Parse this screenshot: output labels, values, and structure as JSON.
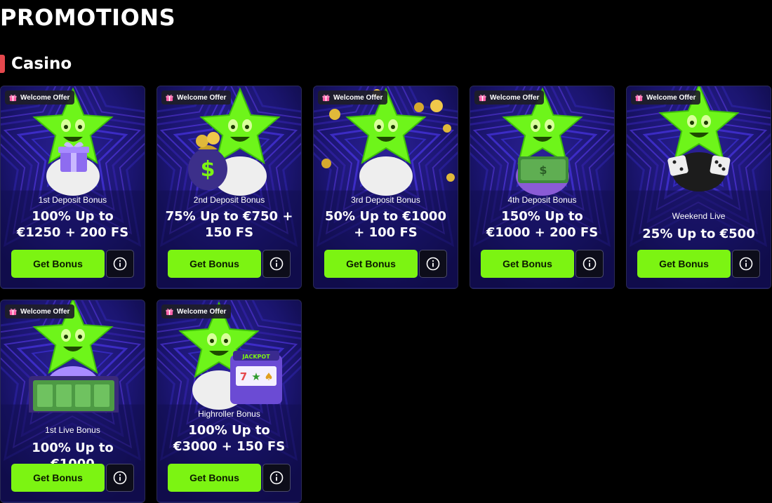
{
  "page": {
    "title": "PROMOTIONS"
  },
  "section": {
    "title": "Casino",
    "accent": "#e5484d"
  },
  "colors": {
    "button": "#7cf412",
    "card_bg": "#1d1a6e",
    "mascot": "#6ef51a"
  },
  "cards": [
    {
      "badge": "Welcome Offer",
      "subtitle": "1st Deposit Bonus",
      "headline": "100% Up to €1250 + 200 FS",
      "button": "Get Bonus",
      "prop": "gift-icon"
    },
    {
      "badge": "Welcome Offer",
      "subtitle": "2nd Deposit Bonus",
      "headline": "75% Up to €750 + 150 FS",
      "button": "Get Bonus",
      "prop": "money-bag-icon"
    },
    {
      "badge": "Welcome Offer",
      "subtitle": "3rd Deposit Bonus",
      "headline": "50% Up to €1000 + 100 FS",
      "button": "Get Bonus",
      "prop": "coins-icon"
    },
    {
      "badge": "Welcome Offer",
      "subtitle": "4th Deposit Bonus",
      "headline": "150% Up to €1000 + 200 FS",
      "button": "Get Bonus",
      "prop": "cash-stack-icon"
    },
    {
      "badge": "Welcome Offer",
      "subtitle": "Weekend Live",
      "headline": "25% Up to €500",
      "button": "Get Bonus",
      "prop": "dice-icon"
    },
    {
      "badge": "Welcome Offer",
      "subtitle": "1st Live Bonus",
      "headline": "100% Up to €1000",
      "button": "Get Bonus",
      "prop": "cash-case-icon"
    },
    {
      "badge": "Welcome Offer",
      "subtitle": "Highroller Bonus",
      "headline": "100% Up to €3000 + 150 FS",
      "button": "Get Bonus",
      "prop": "slot-machine-icon",
      "prop_text": "JACKPOT"
    }
  ]
}
